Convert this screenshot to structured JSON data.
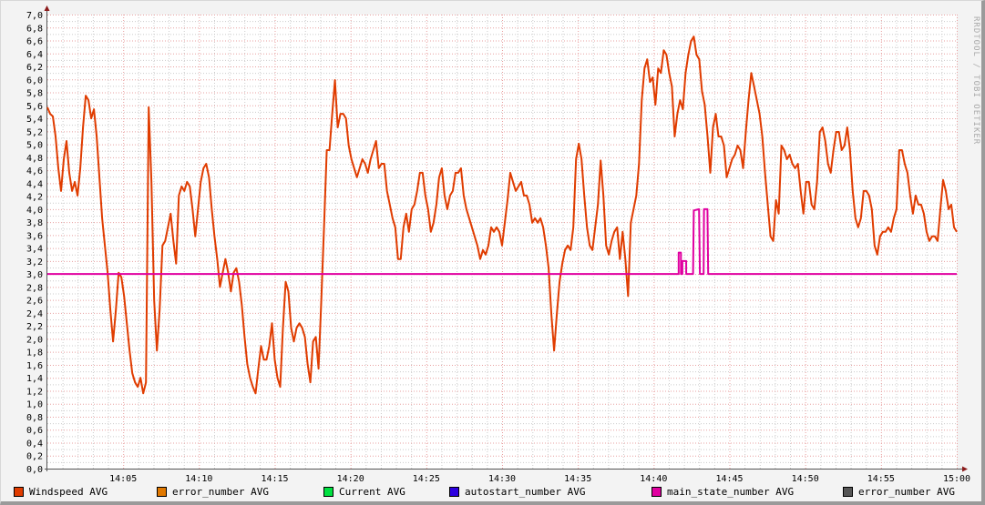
{
  "chart_data": {
    "type": "line",
    "title": "",
    "xlabel": "",
    "ylabel": "",
    "x_range_minutes_after": "14:00",
    "xlim_minutes": [
      0,
      60
    ],
    "ylim": [
      0,
      7
    ],
    "grid": true,
    "x_ticks": [
      "14:05",
      "14:10",
      "14:15",
      "14:20",
      "14:25",
      "14:30",
      "14:35",
      "14:40",
      "14:45",
      "14:50",
      "14:55",
      "15:00"
    ],
    "y_ticks": [
      "0,0",
      "0,2",
      "0,4",
      "0,6",
      "0,8",
      "1,0",
      "1,2",
      "1,4",
      "1,6",
      "1,8",
      "2,0",
      "2,2",
      "2,4",
      "2,6",
      "2,8",
      "3,0",
      "3,2",
      "3,4",
      "3,6",
      "3,8",
      "4,0",
      "4,2",
      "4,4",
      "4,6",
      "4,8",
      "5,0",
      "5,2",
      "5,4",
      "5,6",
      "5,8",
      "6,0",
      "6,2",
      "6,4",
      "6,6",
      "6,8",
      "7,0"
    ],
    "legend_position": "bottom",
    "legend": [
      {
        "name": "Windspeed AVG",
        "color": "#e03c00"
      },
      {
        "name": "error_number AVG",
        "color": "#e07800"
      },
      {
        "name": "Current AVG",
        "color": "#00e040"
      },
      {
        "name": "autostart_number AVG",
        "color": "#2c00e0"
      },
      {
        "name": "main_state_number AVG",
        "color": "#e000a0"
      },
      {
        "name": "error_number AVG",
        "color": "#555555"
      }
    ],
    "series": [
      {
        "name": "Windspeed AVG",
        "color": "#e03c00",
        "sampling": "evenly spaced from 14:00 to 15:00",
        "values": [
          5.57,
          5.47,
          5.43,
          5.12,
          4.63,
          4.28,
          4.77,
          5.05,
          4.56,
          4.28,
          4.42,
          4.21,
          4.63,
          5.26,
          5.75,
          5.68,
          5.4,
          5.54,
          5.12,
          4.49,
          3.86,
          3.44,
          3.02,
          2.45,
          1.96,
          2.45,
          3.02,
          2.95,
          2.66,
          2.24,
          1.82,
          1.47,
          1.33,
          1.26,
          1.4,
          1.16,
          1.33,
          5.57,
          4.42,
          2.59,
          1.82,
          2.45,
          3.44,
          3.51,
          3.72,
          3.93,
          3.51,
          3.16,
          4.21,
          4.35,
          4.28,
          4.42,
          4.35,
          4.0,
          3.58,
          4.0,
          4.42,
          4.63,
          4.7,
          4.49,
          4.0,
          3.58,
          3.23,
          2.8,
          3.02,
          3.23,
          3.02,
          2.73,
          3.02,
          3.09,
          2.88,
          2.52,
          2.03,
          1.61,
          1.4,
          1.26,
          1.16,
          1.54,
          1.89,
          1.68,
          1.68,
          1.89,
          2.24,
          1.68,
          1.4,
          1.26,
          2.17,
          2.88,
          2.73,
          2.17,
          1.96,
          2.17,
          2.24,
          2.17,
          2.03,
          1.61,
          1.33,
          1.96,
          2.03,
          1.54,
          2.59,
          3.72,
          4.91,
          4.91,
          5.47,
          5.99,
          5.26,
          5.47,
          5.47,
          5.4,
          4.98,
          4.77,
          4.63,
          4.49,
          4.63,
          4.77,
          4.7,
          4.56,
          4.77,
          4.91,
          5.05,
          4.63,
          4.7,
          4.7,
          4.28,
          4.07,
          3.86,
          3.72,
          3.23,
          3.23,
          3.72,
          3.93,
          3.65,
          4.0,
          4.07,
          4.28,
          4.56,
          4.56,
          4.21,
          4.0,
          3.65,
          3.79,
          4.07,
          4.49,
          4.63,
          4.21,
          4.0,
          4.21,
          4.28,
          4.56,
          4.56,
          4.63,
          4.21,
          4.0,
          3.86,
          3.72,
          3.58,
          3.44,
          3.23,
          3.37,
          3.3,
          3.44,
          3.72,
          3.65,
          3.72,
          3.65,
          3.44,
          3.79,
          4.14,
          4.56,
          4.42,
          4.28,
          4.35,
          4.42,
          4.21,
          4.21,
          4.07,
          3.79,
          3.86,
          3.79,
          3.86,
          3.72,
          3.44,
          3.09,
          2.38,
          1.82,
          2.38,
          2.88,
          3.16,
          3.37,
          3.44,
          3.37,
          3.72,
          4.77,
          5.01,
          4.77,
          4.21,
          3.72,
          3.44,
          3.37,
          3.72,
          4.07,
          4.75,
          4.21,
          3.44,
          3.3,
          3.51,
          3.65,
          3.72,
          3.23,
          3.65,
          3.23,
          2.66,
          3.79,
          4.0,
          4.21,
          4.7,
          5.68,
          6.17,
          6.31,
          5.96,
          6.03,
          5.61,
          6.17,
          6.1,
          6.45,
          6.38,
          6.1,
          5.89,
          5.12,
          5.47,
          5.68,
          5.54,
          6.1,
          6.38,
          6.59,
          6.66,
          6.38,
          6.31,
          5.82,
          5.61,
          5.12,
          4.56,
          5.26,
          5.47,
          5.12,
          5.12,
          4.98,
          4.49,
          4.63,
          4.77,
          4.84,
          4.98,
          4.91,
          4.63,
          5.19,
          5.68,
          6.1,
          5.89,
          5.68,
          5.47,
          5.12,
          4.56,
          4.07,
          3.58,
          3.51,
          4.14,
          3.93,
          4.98,
          4.91,
          4.77,
          4.84,
          4.7,
          4.63,
          4.7,
          4.28,
          3.93,
          4.42,
          4.42,
          4.07,
          4.0,
          4.42,
          5.19,
          5.26,
          5.05,
          4.7,
          4.56,
          4.91,
          5.19,
          5.19,
          4.91,
          4.98,
          5.26,
          4.91,
          4.28,
          3.86,
          3.72,
          3.86,
          4.28,
          4.28,
          4.21,
          4.0,
          3.44,
          3.3,
          3.58,
          3.65,
          3.65,
          3.72,
          3.65,
          3.86,
          4.0,
          4.91,
          4.91,
          4.7,
          4.56,
          4.21,
          3.93,
          4.21,
          4.07,
          4.07,
          3.93,
          3.65,
          3.51,
          3.58,
          3.58,
          3.51,
          4.0,
          4.45,
          4.28,
          4.0,
          4.07,
          3.72,
          3.65
        ]
      },
      {
        "name": "main_state_number AVG",
        "color": "#e000a0",
        "points": [
          [
            0,
            3
          ],
          [
            41.65,
            3
          ],
          [
            41.65,
            3.33
          ],
          [
            41.8,
            3.33
          ],
          [
            41.8,
            3
          ],
          [
            41.9,
            3
          ],
          [
            41.9,
            3.2
          ],
          [
            42.15,
            3.2
          ],
          [
            42.15,
            3
          ],
          [
            42.6,
            3
          ],
          [
            42.65,
            3.98
          ],
          [
            43.0,
            4.0
          ],
          [
            43.05,
            3
          ],
          [
            43.3,
            3
          ],
          [
            43.32,
            4.0
          ],
          [
            43.55,
            4.0
          ],
          [
            43.6,
            3
          ],
          [
            60,
            3
          ]
        ]
      }
    ]
  },
  "watermark": "RRDTOOL / TOBI OETIKER"
}
